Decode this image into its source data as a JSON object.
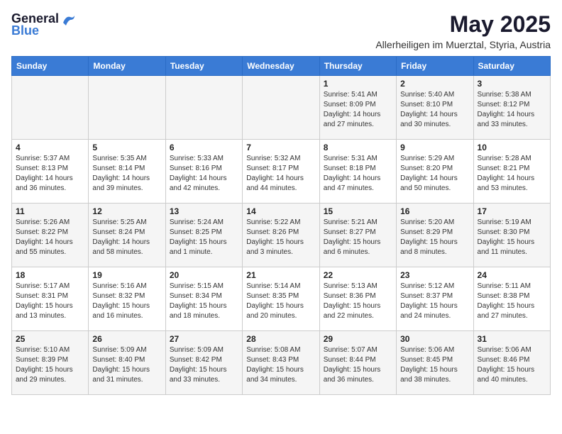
{
  "header": {
    "logo_general": "General",
    "logo_blue": "Blue",
    "month_year": "May 2025",
    "location": "Allerheiligen im Muerztal, Styria, Austria"
  },
  "days_of_week": [
    "Sunday",
    "Monday",
    "Tuesday",
    "Wednesday",
    "Thursday",
    "Friday",
    "Saturday"
  ],
  "weeks": [
    [
      {
        "day": "",
        "info": ""
      },
      {
        "day": "",
        "info": ""
      },
      {
        "day": "",
        "info": ""
      },
      {
        "day": "",
        "info": ""
      },
      {
        "day": "1",
        "info": "Sunrise: 5:41 AM\nSunset: 8:09 PM\nDaylight: 14 hours\nand 27 minutes."
      },
      {
        "day": "2",
        "info": "Sunrise: 5:40 AM\nSunset: 8:10 PM\nDaylight: 14 hours\nand 30 minutes."
      },
      {
        "day": "3",
        "info": "Sunrise: 5:38 AM\nSunset: 8:12 PM\nDaylight: 14 hours\nand 33 minutes."
      }
    ],
    [
      {
        "day": "4",
        "info": "Sunrise: 5:37 AM\nSunset: 8:13 PM\nDaylight: 14 hours\nand 36 minutes."
      },
      {
        "day": "5",
        "info": "Sunrise: 5:35 AM\nSunset: 8:14 PM\nDaylight: 14 hours\nand 39 minutes."
      },
      {
        "day": "6",
        "info": "Sunrise: 5:33 AM\nSunset: 8:16 PM\nDaylight: 14 hours\nand 42 minutes."
      },
      {
        "day": "7",
        "info": "Sunrise: 5:32 AM\nSunset: 8:17 PM\nDaylight: 14 hours\nand 44 minutes."
      },
      {
        "day": "8",
        "info": "Sunrise: 5:31 AM\nSunset: 8:18 PM\nDaylight: 14 hours\nand 47 minutes."
      },
      {
        "day": "9",
        "info": "Sunrise: 5:29 AM\nSunset: 8:20 PM\nDaylight: 14 hours\nand 50 minutes."
      },
      {
        "day": "10",
        "info": "Sunrise: 5:28 AM\nSunset: 8:21 PM\nDaylight: 14 hours\nand 53 minutes."
      }
    ],
    [
      {
        "day": "11",
        "info": "Sunrise: 5:26 AM\nSunset: 8:22 PM\nDaylight: 14 hours\nand 55 minutes."
      },
      {
        "day": "12",
        "info": "Sunrise: 5:25 AM\nSunset: 8:24 PM\nDaylight: 14 hours\nand 58 minutes."
      },
      {
        "day": "13",
        "info": "Sunrise: 5:24 AM\nSunset: 8:25 PM\nDaylight: 15 hours\nand 1 minute."
      },
      {
        "day": "14",
        "info": "Sunrise: 5:22 AM\nSunset: 8:26 PM\nDaylight: 15 hours\nand 3 minutes."
      },
      {
        "day": "15",
        "info": "Sunrise: 5:21 AM\nSunset: 8:27 PM\nDaylight: 15 hours\nand 6 minutes."
      },
      {
        "day": "16",
        "info": "Sunrise: 5:20 AM\nSunset: 8:29 PM\nDaylight: 15 hours\nand 8 minutes."
      },
      {
        "day": "17",
        "info": "Sunrise: 5:19 AM\nSunset: 8:30 PM\nDaylight: 15 hours\nand 11 minutes."
      }
    ],
    [
      {
        "day": "18",
        "info": "Sunrise: 5:17 AM\nSunset: 8:31 PM\nDaylight: 15 hours\nand 13 minutes."
      },
      {
        "day": "19",
        "info": "Sunrise: 5:16 AM\nSunset: 8:32 PM\nDaylight: 15 hours\nand 16 minutes."
      },
      {
        "day": "20",
        "info": "Sunrise: 5:15 AM\nSunset: 8:34 PM\nDaylight: 15 hours\nand 18 minutes."
      },
      {
        "day": "21",
        "info": "Sunrise: 5:14 AM\nSunset: 8:35 PM\nDaylight: 15 hours\nand 20 minutes."
      },
      {
        "day": "22",
        "info": "Sunrise: 5:13 AM\nSunset: 8:36 PM\nDaylight: 15 hours\nand 22 minutes."
      },
      {
        "day": "23",
        "info": "Sunrise: 5:12 AM\nSunset: 8:37 PM\nDaylight: 15 hours\nand 24 minutes."
      },
      {
        "day": "24",
        "info": "Sunrise: 5:11 AM\nSunset: 8:38 PM\nDaylight: 15 hours\nand 27 minutes."
      }
    ],
    [
      {
        "day": "25",
        "info": "Sunrise: 5:10 AM\nSunset: 8:39 PM\nDaylight: 15 hours\nand 29 minutes."
      },
      {
        "day": "26",
        "info": "Sunrise: 5:09 AM\nSunset: 8:40 PM\nDaylight: 15 hours\nand 31 minutes."
      },
      {
        "day": "27",
        "info": "Sunrise: 5:09 AM\nSunset: 8:42 PM\nDaylight: 15 hours\nand 33 minutes."
      },
      {
        "day": "28",
        "info": "Sunrise: 5:08 AM\nSunset: 8:43 PM\nDaylight: 15 hours\nand 34 minutes."
      },
      {
        "day": "29",
        "info": "Sunrise: 5:07 AM\nSunset: 8:44 PM\nDaylight: 15 hours\nand 36 minutes."
      },
      {
        "day": "30",
        "info": "Sunrise: 5:06 AM\nSunset: 8:45 PM\nDaylight: 15 hours\nand 38 minutes."
      },
      {
        "day": "31",
        "info": "Sunrise: 5:06 AM\nSunset: 8:46 PM\nDaylight: 15 hours\nand 40 minutes."
      }
    ]
  ]
}
